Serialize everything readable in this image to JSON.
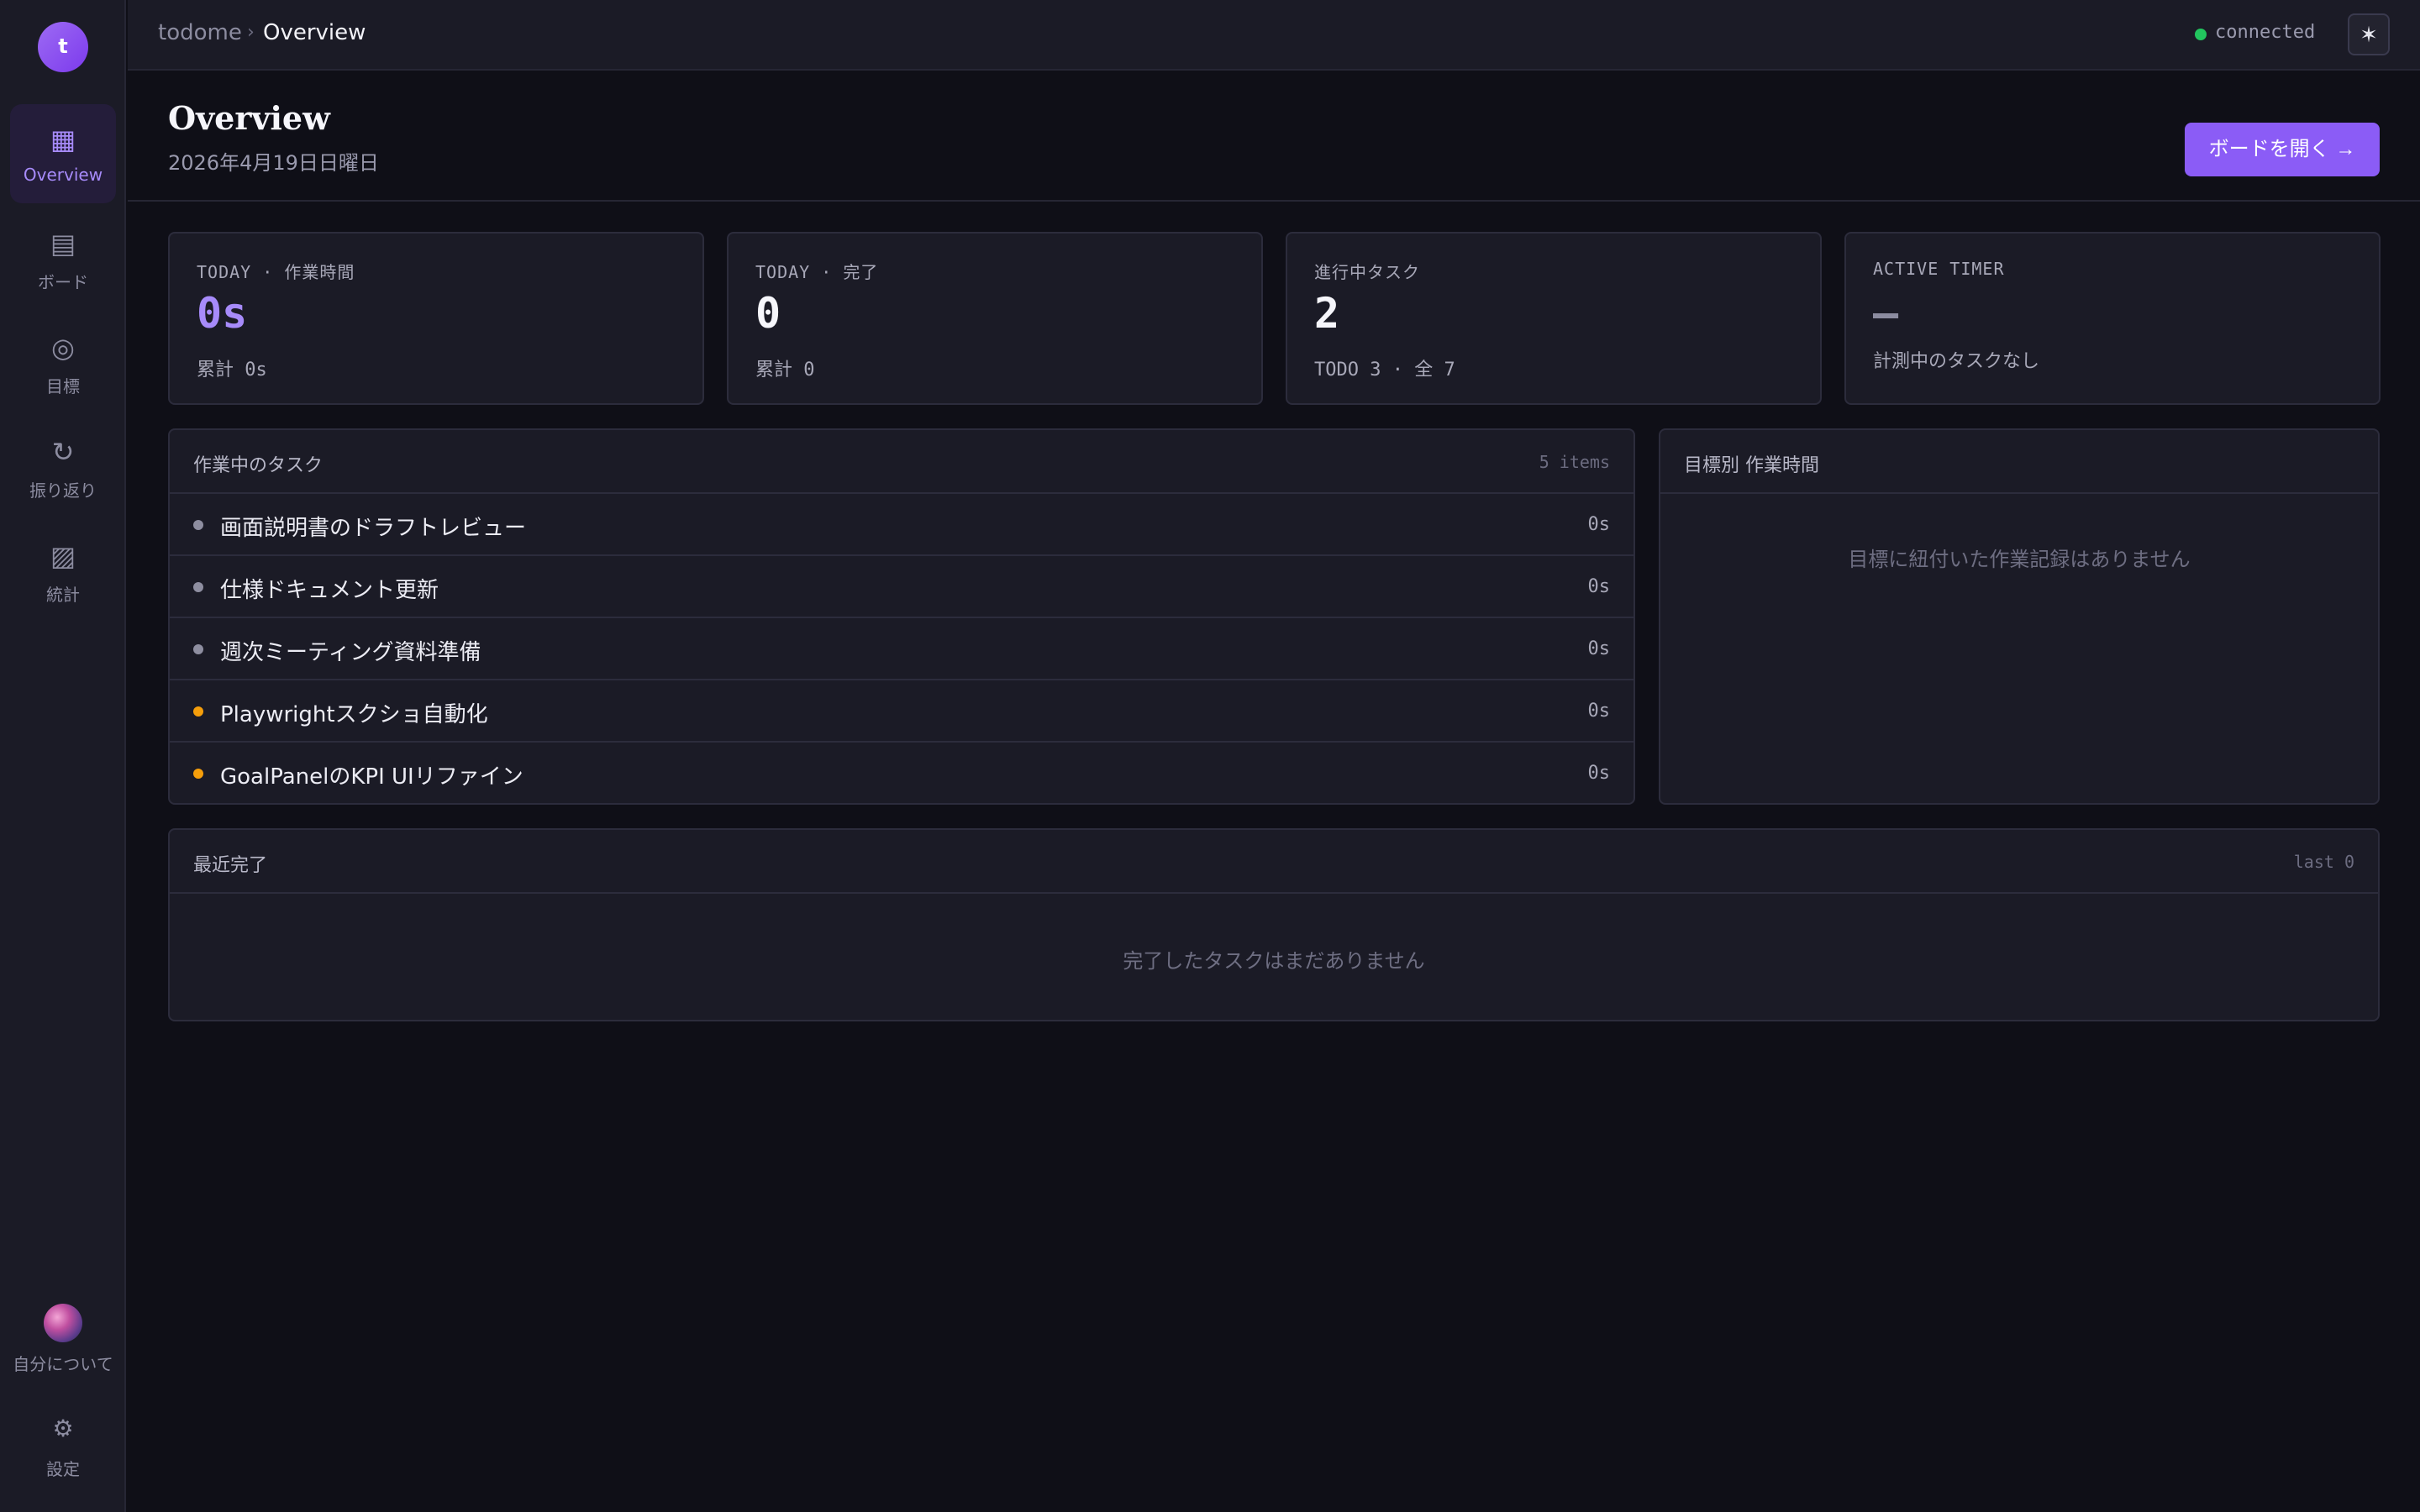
{
  "app": {
    "logo_letter": "t"
  },
  "sidebar": {
    "items": [
      {
        "label": "Overview",
        "icon": "▦"
      },
      {
        "label": "ボード",
        "icon": "▤"
      },
      {
        "label": "目標",
        "icon": "◎"
      },
      {
        "label": "振り返り",
        "icon": "↻"
      },
      {
        "label": "統計",
        "icon": "▨"
      }
    ],
    "me_label": "自分について",
    "settings_icon": "⚙",
    "settings_label": "設定"
  },
  "topbar": {
    "breadcrumb_root": "todome",
    "breadcrumb_sep": "›",
    "breadcrumb_current": "Overview",
    "status_text": "connected",
    "status_color": "#22c55e",
    "theme_icon": "✶"
  },
  "header": {
    "title": "Overview",
    "date": "2026年4月19日日曜日",
    "open_board_label": "ボードを開く →"
  },
  "stats": [
    {
      "label": "TODAY · 作業時間",
      "value": "0s",
      "sub": "累計 0s"
    },
    {
      "label": "TODAY · 完了",
      "value": "0",
      "sub": "累計 0"
    },
    {
      "label": "進行中タスク",
      "value": "2",
      "sub": "TODO 3 · 全 7"
    },
    {
      "label": "ACTIVE TIMER",
      "value": "—",
      "sub": "計測中のタスクなし"
    }
  ],
  "active_tasks": {
    "title": "作業中のタスク",
    "count": "5 items",
    "rows": [
      {
        "name": "画面説明書のドラフトレビュー",
        "time": "0s",
        "dot": "#8e8ea0"
      },
      {
        "name": "仕様ドキュメント更新",
        "time": "0s",
        "dot": "#8e8ea0"
      },
      {
        "name": "週次ミーティング資料準備",
        "time": "0s",
        "dot": "#8e8ea0"
      },
      {
        "name": "Playwrightスクショ自動化",
        "time": "0s",
        "dot": "#f59e0b"
      },
      {
        "name": "GoalPanelのKPI UIリファイン",
        "time": "0s",
        "dot": "#f59e0b"
      }
    ]
  },
  "goal_time": {
    "title": "目標別 作業時間",
    "empty": "目標に紐付いた作業記録はありません"
  },
  "recent_done": {
    "title": "最近完了",
    "meta": "last 0",
    "empty": "完了したタスクはまだありません"
  },
  "colors": {
    "accent": "#8b5cf6",
    "accent_text": "#a78bfa"
  }
}
